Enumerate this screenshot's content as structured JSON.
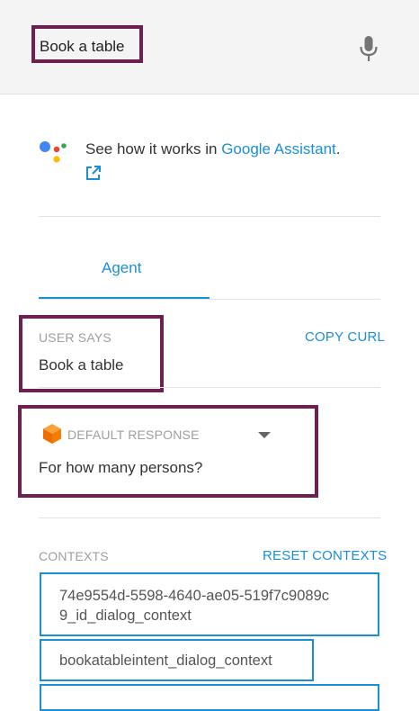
{
  "query": {
    "text": "Book a table"
  },
  "assistant": {
    "prefix": "See how it works in ",
    "link": "Google Assistant",
    "suffix": ".",
    "dot_colors": {
      "blue": "#4285F4",
      "red": "#EA4335",
      "yellow": "#FBBC05",
      "green": "#34A853"
    }
  },
  "tabs": [
    {
      "label": "Agent",
      "active": true
    }
  ],
  "user_says": {
    "label": "USER SAYS",
    "copy_curl": "COPY CURL",
    "value": "Book a table"
  },
  "default_response": {
    "label": "DEFAULT RESPONSE",
    "value": "For how many persons?"
  },
  "contexts": {
    "label": "CONTEXTS",
    "reset": "RESET CONTEXTS",
    "items": [
      {
        "line1": "74e9554d-5598-4640-ae05-519f7c9089c",
        "line2": "9_id_dialog_context"
      },
      {
        "line1": "bookatableintent_dialog_context"
      }
    ]
  },
  "colors": {
    "accent": "#1a8fd6",
    "highlight": "#6d1f4f"
  }
}
